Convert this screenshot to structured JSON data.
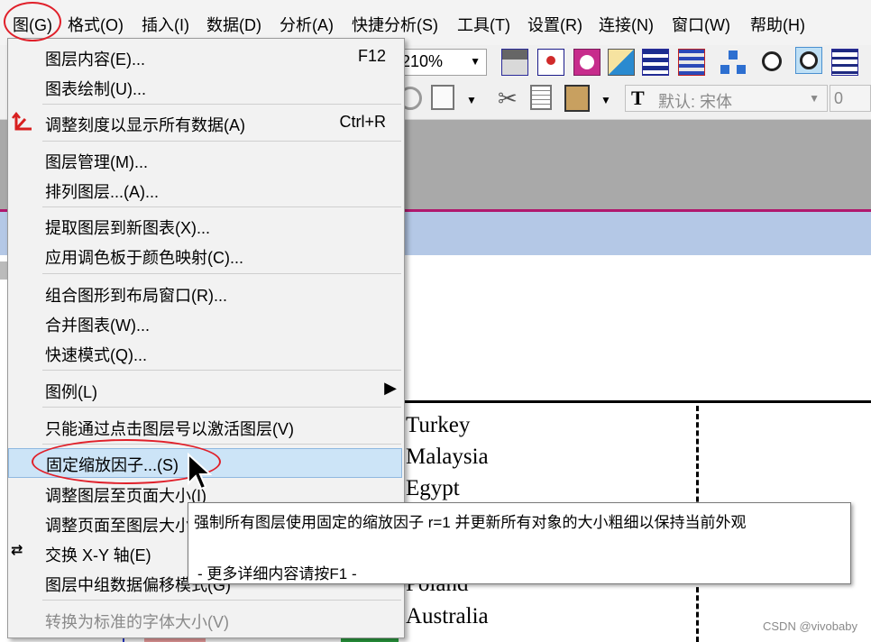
{
  "menubar": [
    "图(G)",
    "格式(O)",
    "插入(I)",
    "数据(D)",
    "分析(A)",
    "快捷分析(S)",
    "工具(T)",
    "设置(R)",
    "连接(N)",
    "窗口(W)",
    "帮助(H)"
  ],
  "toolbar": {
    "zoom_value": "210%",
    "font_name": "默认: 宋体",
    "font_size": "0"
  },
  "graph_menu": {
    "items": [
      {
        "label": "图层内容(E)...",
        "shortcut": "F12"
      },
      {
        "label": "图表绘制(U)...",
        "shortcut": ""
      },
      {
        "label": "调整刻度以显示所有数据(A)",
        "shortcut": "Ctrl+R"
      },
      {
        "label": "图层管理(M)...",
        "shortcut": ""
      },
      {
        "label": "排列图层...(A)...",
        "shortcut": ""
      },
      {
        "label": "提取图层到新图表(X)...",
        "shortcut": ""
      },
      {
        "label": "应用调色板于颜色映射(C)...",
        "shortcut": ""
      },
      {
        "label": "组合图形到布局窗口(R)...",
        "shortcut": ""
      },
      {
        "label": "合并图表(W)...",
        "shortcut": ""
      },
      {
        "label": "快速模式(Q)...",
        "shortcut": ""
      },
      {
        "label": "图例(L)",
        "shortcut": ""
      },
      {
        "label": "只能通过点击图层号以激活图层(V)",
        "shortcut": ""
      },
      {
        "label": "固定缩放因子...(S)",
        "shortcut": ""
      },
      {
        "label": "调整图层至页面大小(I)",
        "shortcut": ""
      },
      {
        "label": "调整页面至图层大小",
        "shortcut": ""
      },
      {
        "label": "交换 X-Y 轴(E)",
        "shortcut": ""
      },
      {
        "label": "图层中组数据偏移模式(G)",
        "shortcut": ""
      },
      {
        "label": "转换为标准的字体大小(V)",
        "shortcut": ""
      }
    ]
  },
  "tooltip": {
    "line1": "强制所有图层使用固定的缩放因子 r=1 并更新所有对象的大小粗细以保持当前外观",
    "line2": "- 更多详细内容请按F1 -"
  },
  "legend_countries": [
    "Turkey",
    "Malaysia",
    "Egypt",
    "Poland",
    "Australia"
  ],
  "watermark": "CSDN @vivobaby",
  "colors": {
    "highlight": "#cce4f7",
    "annotation_red": "#e0202a",
    "accent_bar": "#b0186e"
  }
}
